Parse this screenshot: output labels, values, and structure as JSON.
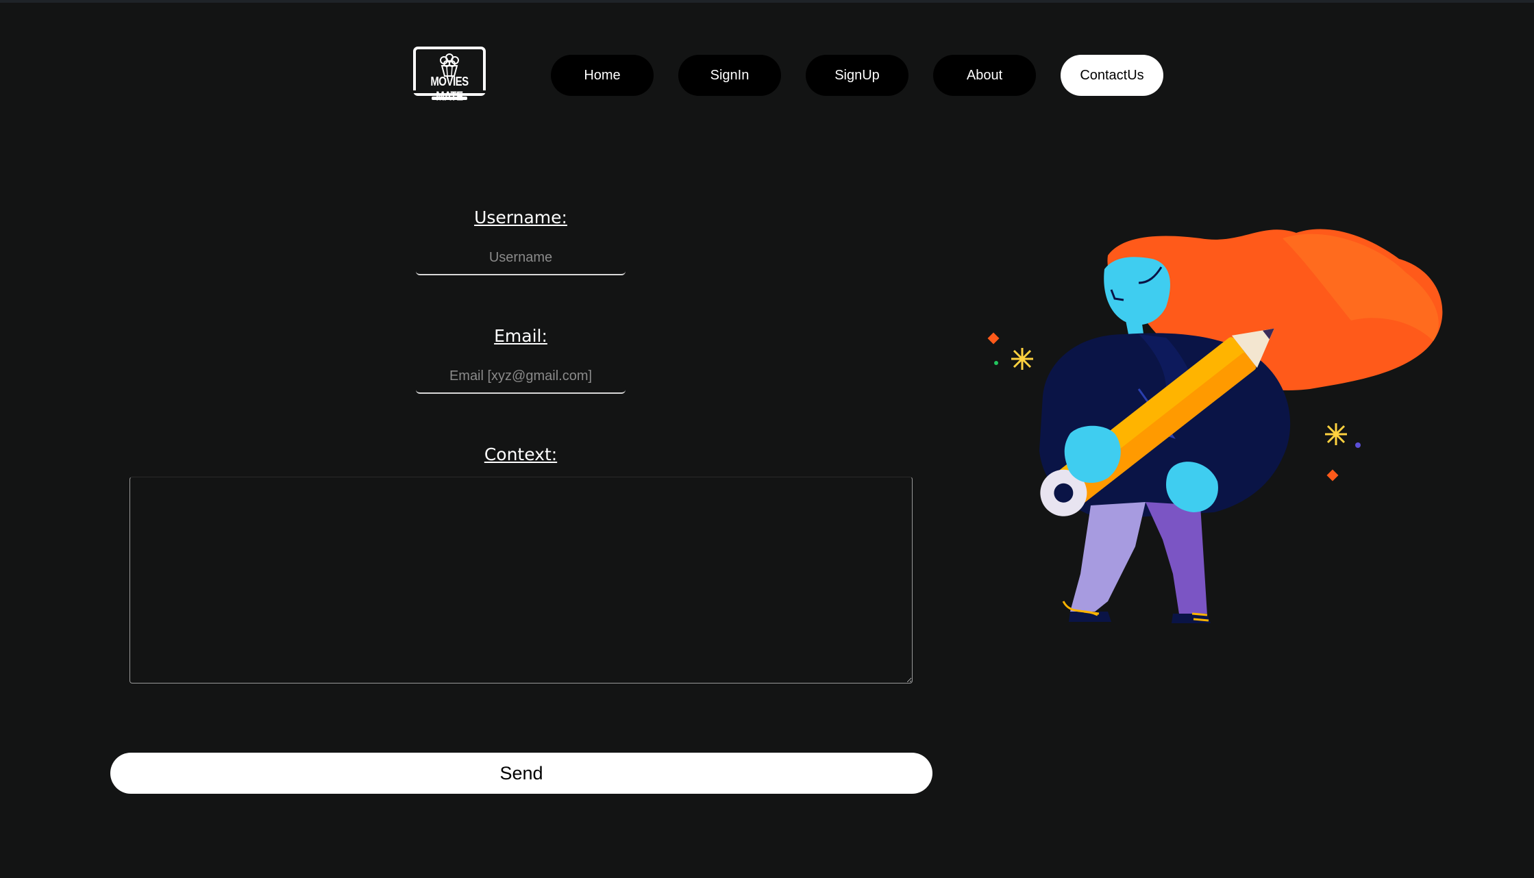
{
  "brand": {
    "logo_text": "MOVIES MATE",
    "logo_icon": "laptop-popcorn-icon"
  },
  "nav": {
    "items": [
      {
        "label": "Home",
        "active": false
      },
      {
        "label": "SignIn",
        "active": false
      },
      {
        "label": "SignUp",
        "active": false
      },
      {
        "label": "About",
        "active": false
      },
      {
        "label": "ContactUs",
        "active": true
      }
    ]
  },
  "form": {
    "username": {
      "label": "Username:",
      "placeholder": "Username",
      "value": ""
    },
    "email": {
      "label": "Email:",
      "placeholder": "Email [xyz@gmail.com]",
      "value": ""
    },
    "context": {
      "label": "Context:",
      "value": ""
    },
    "send_label": "Send"
  },
  "illustration": {
    "icon": "woman-holding-pencil-illustration"
  },
  "colors": {
    "background": "#131414",
    "nav_button": "#000000",
    "nav_active": "#ffffff",
    "hair": "#ff5a1a",
    "pencil": "#ffb400",
    "skin": "#3fcdf0",
    "jacket": "#0a1446",
    "pants": "#8d7fd6"
  }
}
